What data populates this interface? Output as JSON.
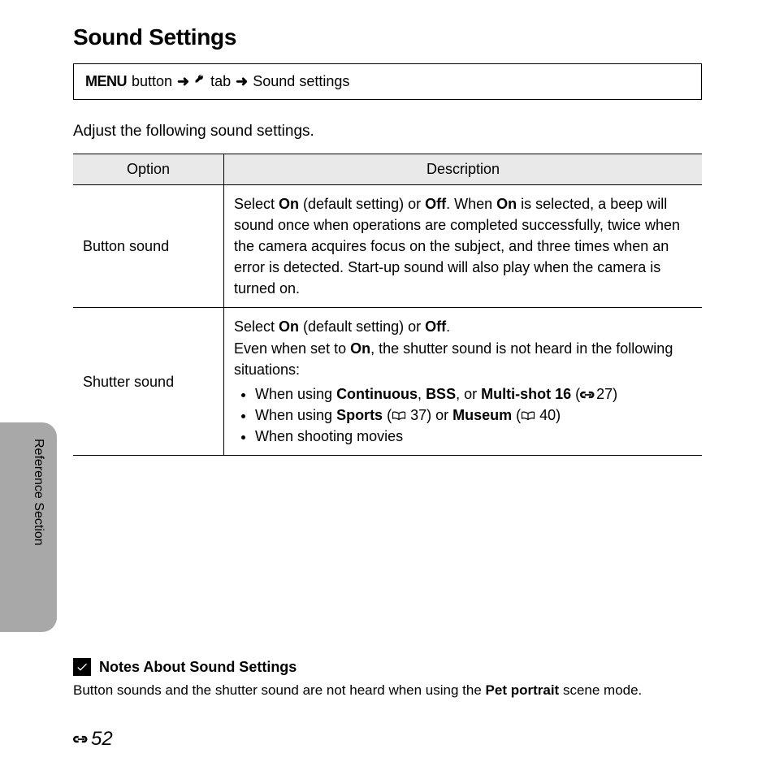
{
  "title": "Sound Settings",
  "breadcrumb": {
    "menu": "MENU",
    "step1": "button",
    "step2": "tab",
    "step3": "Sound settings"
  },
  "intro": "Adjust the following sound settings.",
  "table": {
    "head_option": "Option",
    "head_desc": "Description",
    "row1": {
      "option": "Button sound",
      "desc_prefix": "Select ",
      "on": "On",
      "default_text": " (default setting) or ",
      "off": "Off",
      "sentence_after_off": ". When ",
      "on2": "On",
      "sentence_rest": " is selected, a beep will sound once when operations are completed successfully, twice when the camera acquires focus on the subject, and three times when an error is detected. Start-up sound will also play when the camera is turned on."
    },
    "row2": {
      "option": "Shutter sound",
      "line1_prefix": "Select ",
      "line1_on": "On",
      "line1_mid": " (default setting) or ",
      "line1_off": "Off",
      "line1_end": ".",
      "line2_prefix": "Even when set to ",
      "line2_on": "On",
      "line2_rest": ", the shutter sound is not heard in the following situations:",
      "bullet1_prefix": "When using ",
      "bullet1_b1": "Continuous",
      "bullet1_mid1": ", ",
      "bullet1_b2": "BSS",
      "bullet1_mid2": ", or ",
      "bullet1_b3": "Multi-shot 16",
      "bullet1_ref_open": " (",
      "bullet1_ref_num": "27)",
      "bullet2_prefix": "When using ",
      "bullet2_b1": "Sports",
      "bullet2_ref1_open": " (",
      "bullet2_ref1_num": " 37) or ",
      "bullet2_b2": "Museum",
      "bullet2_ref2_open": " (",
      "bullet2_ref2_num": " 40)",
      "bullet3": "When shooting movies"
    }
  },
  "side_label": "Reference Section",
  "notes": {
    "title": "Notes About Sound Settings",
    "body_prefix": "Button sounds and the shutter sound are not heard when using the ",
    "body_bold": "Pet portrait",
    "body_suffix": " scene mode."
  },
  "page_number": "52"
}
